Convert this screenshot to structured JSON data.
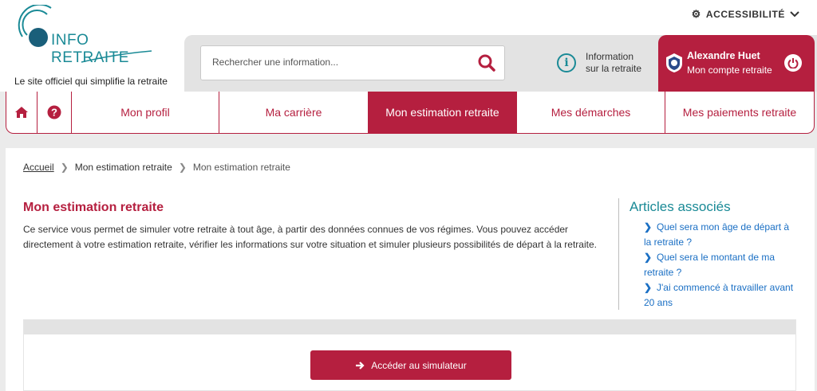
{
  "header": {
    "logo_text": "INFO RETRAITE",
    "tagline": "Le site officiel qui simplifie la retraite",
    "accessibility_label": "ACCESSIBILITÉ",
    "search_placeholder": "Rechercher une information...",
    "info_line1": "Information",
    "info_line2": "sur la retraite",
    "user_name": "Alexandre Huet",
    "account_label": "Mon compte retraite"
  },
  "nav": {
    "items": [
      {
        "label": "Mon profil"
      },
      {
        "label": "Ma carrière"
      },
      {
        "label": "Mon estimation retraite",
        "active": true
      },
      {
        "label": "Mes démarches"
      },
      {
        "label": "Mes paiements retraite"
      }
    ]
  },
  "breadcrumb": {
    "home": "Accueil",
    "level1": "Mon estimation retraite",
    "level2": "Mon estimation retraite"
  },
  "main": {
    "title": "Mon estimation retraite",
    "description": "Ce service vous permet de simuler votre retraite à tout âge, à partir des données connues de vos régimes. Vous pouvez accéder directement à votre estimation retraite, vérifier les informations sur votre situation et simuler plusieurs possibilités de départ à la retraite.",
    "button_label": "Accéder au simulateur"
  },
  "articles": {
    "title": "Articles associés",
    "items": [
      {
        "label": "Quel sera mon âge de départ à la retraite ?"
      },
      {
        "label": "Quel sera le montant de ma retraite ?"
      },
      {
        "label": "J'ai commencé à travailler avant 20 ans"
      }
    ]
  },
  "colors": {
    "brand_red": "#b51f3f",
    "teal": "#1a8a96",
    "link_blue": "#1a6fc4"
  }
}
